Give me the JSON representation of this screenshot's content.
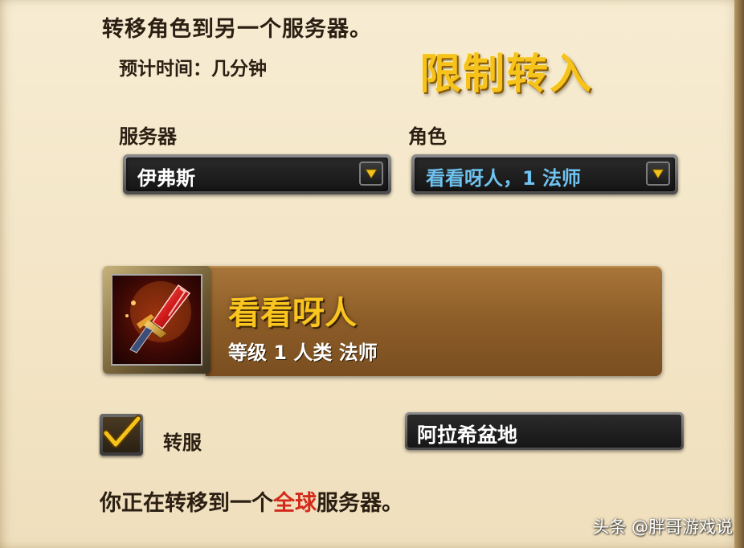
{
  "header": {
    "title": "转移角色到另一个服务器。",
    "eta": "预计时间：几分钟",
    "restriction_notice": "限制转入"
  },
  "server_select": {
    "label": "服务器",
    "value": "伊弗斯",
    "value_color": "#ffffff"
  },
  "character_select": {
    "label": "角色",
    "value": "看看呀人，1 法师",
    "value_color": "#6fc3f0"
  },
  "character_card": {
    "name": "看看呀人",
    "info": "等级 1 人类 法师",
    "portrait_icon": "red-crystal-dagger-icon",
    "name_color": "#f9c51e"
  },
  "transfer_option": {
    "checked": true,
    "label": "转服",
    "destination_realm": "阿拉希盆地"
  },
  "footer": {
    "text_before": "你正在转移到一个",
    "highlight": "全球",
    "text_after": "服务器。",
    "highlight_color": "#d42a1b"
  },
  "watermark": "头条 @胖哥游戏说"
}
